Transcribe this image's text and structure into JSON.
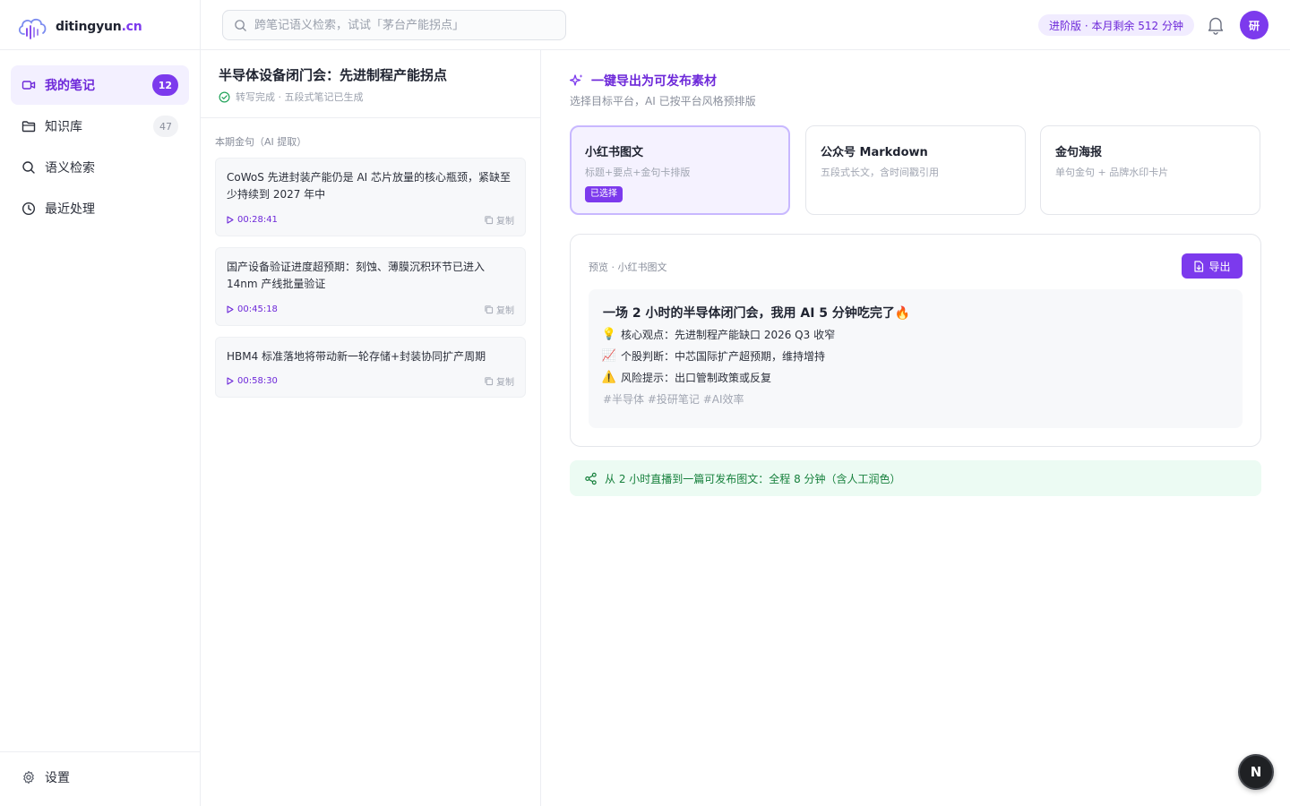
{
  "brand": {
    "name_main": "ditingyun",
    "name_accent": ".cn"
  },
  "sidebar": {
    "items": [
      {
        "label": "我的笔记",
        "badge": "12",
        "icon": "video-icon",
        "active": true
      },
      {
        "label": "知识库",
        "badge": "47",
        "icon": "folder-icon",
        "active": false
      },
      {
        "label": "语义检索",
        "badge": "",
        "icon": "search-icon",
        "active": false
      },
      {
        "label": "最近处理",
        "badge": "",
        "icon": "clock-icon",
        "active": false
      }
    ],
    "settings_label": "设置"
  },
  "topbar": {
    "search_placeholder": "跨笔记语义检索，试试「茅台产能拐点」",
    "plan_text": "进阶版 · 本月剩余 512 分钟",
    "avatar_text": "研"
  },
  "note": {
    "title": "半导体设备闭门会：先进制程产能拐点",
    "status": "转写完成 · 五段式笔记已生成",
    "quotes_label": "本期金句（AI 提取）",
    "copy_label": "复制",
    "quotes": [
      {
        "text": "CoWoS 先进封装产能仍是 AI 芯片放量的核心瓶颈，紧缺至少持续到 2027 年中",
        "time": "00:28:41"
      },
      {
        "text": "国产设备验证进度超预期：刻蚀、薄膜沉积环节已进入 14nm 产线批量验证",
        "time": "00:45:18"
      },
      {
        "text": "HBM4 标准落地将带动新一轮存储+封装协同扩产周期",
        "time": "00:58:30"
      }
    ]
  },
  "export": {
    "title": "一键导出为可发布素材",
    "subtitle": "选择目标平台，AI 已按平台风格预排版",
    "platforms": [
      {
        "name": "小红书图文",
        "desc": "标题+要点+金句卡排版",
        "selected": true,
        "badge": "已选择"
      },
      {
        "name": "公众号 Markdown",
        "desc": "五段式长文，含时间戳引用",
        "selected": false
      },
      {
        "name": "金句海报",
        "desc": "单句金句 + 品牌水印卡片",
        "selected": false
      }
    ],
    "preview": {
      "label": "预览 · 小红书图文",
      "export_button": "导出",
      "title": "一场 2 小时的半导体闭门会，我用 AI 5 分钟吃完了🔥",
      "lines": [
        {
          "emoji": "💡",
          "text": "核心观点：先进制程产能缺口 2026 Q3 收窄"
        },
        {
          "emoji": "📈",
          "text": "个股判断：中芯国际扩产超预期，维持增持"
        },
        {
          "emoji": "⚠️",
          "text": "风险提示：出口管制政策或反复"
        }
      ],
      "tags": "#半导体 #投研笔记 #AI效率"
    },
    "summary": "从 2 小时直播到一篇可发布图文：全程 8 分钟（含人工润色）"
  },
  "fab": {
    "label": "N"
  },
  "colors": {
    "accent": "#7c3aed",
    "success": "#16803c"
  }
}
